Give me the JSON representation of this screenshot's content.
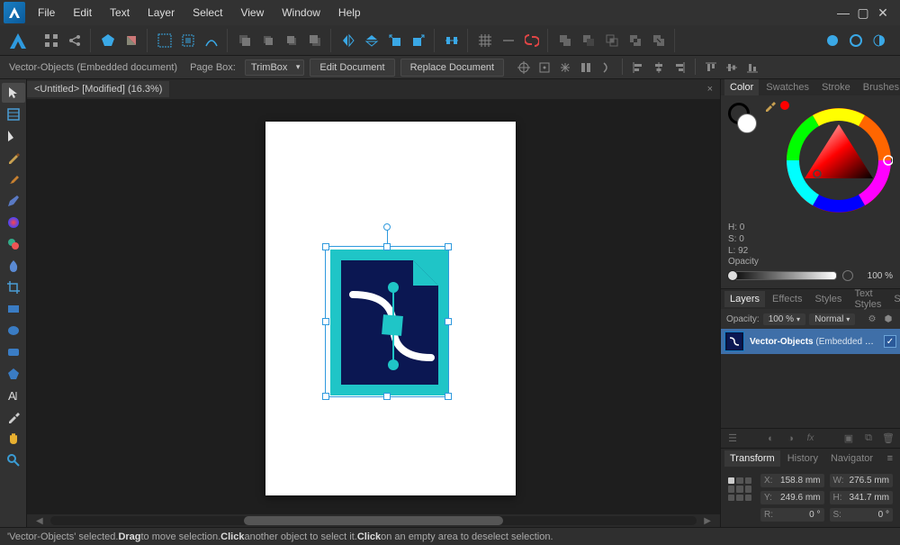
{
  "menu": {
    "items": [
      "File",
      "Edit",
      "Text",
      "Layer",
      "Select",
      "View",
      "Window",
      "Help"
    ]
  },
  "document": {
    "tab_title": "<Untitled> [Modified] (16.3%)"
  },
  "context": {
    "object_label": "Vector-Objects (Embedded document)",
    "pagebox_label": "Page Box:",
    "pagebox_value": "TrimBox",
    "edit_btn": "Edit Document",
    "replace_btn": "Replace Document"
  },
  "panels": {
    "color_tabs": [
      "Color",
      "Swatches",
      "Stroke",
      "Brushes"
    ],
    "hsl": {
      "h_label": "H:",
      "h": "0",
      "s_label": "S:",
      "s": "0",
      "l_label": "L:",
      "l": "92"
    },
    "opacity": {
      "label": "Opacity",
      "value": "100 %"
    },
    "layer_tabs": [
      "Layers",
      "Effects",
      "Styles",
      "Text Styles",
      "Stock"
    ],
    "layer_toolbar": {
      "opacity_label": "Opacity:",
      "opacity_value": "100 %",
      "blend_value": "Normal"
    },
    "layer_item": {
      "name": "Vector-Objects",
      "suffix": "(Embedded d…"
    },
    "transform_tabs": [
      "Transform",
      "History",
      "Navigator"
    ],
    "transform": {
      "x_label": "X:",
      "x": "158.8 mm",
      "y_label": "Y:",
      "y": "249.6 mm",
      "w_label": "W:",
      "w": "276.5 mm",
      "h_label": "H:",
      "h": "341.7 mm",
      "r_label": "R:",
      "r": "0 °",
      "s_label": "S:",
      "s": "0 °"
    }
  },
  "status": {
    "pre": "'Vector-Objects' selected. ",
    "b1": "Drag",
    "t1": " to move selection. ",
    "b2": "Click",
    "t2": " another object to select it. ",
    "b3": "Click",
    "t3": " on an empty area to deselect selection."
  }
}
